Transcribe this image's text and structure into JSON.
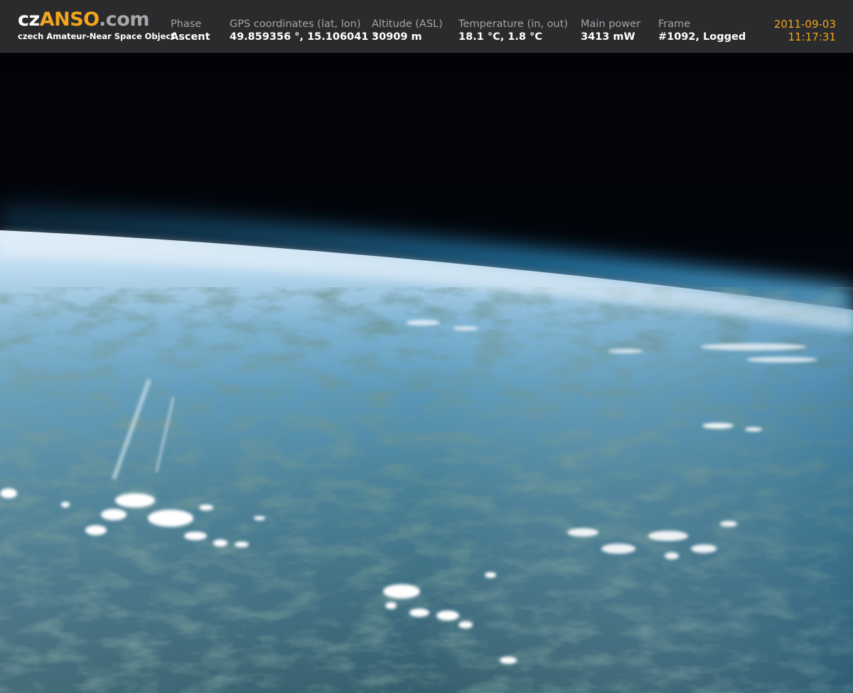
{
  "brand": {
    "logo_prefix": "cz",
    "logo_accent": "ANSO",
    "logo_suffix": ".com",
    "tagline": "czech Amateur-Near Space Object"
  },
  "telemetry": {
    "phase": {
      "label": "Phase",
      "value": "Ascent"
    },
    "gps": {
      "label": "GPS coordinates (lat, lon)",
      "value": "49.859356 °, 15.106041 °"
    },
    "altitude": {
      "label": "Altitude (ASL)",
      "value": "30909 m"
    },
    "temperature": {
      "label": "Temperature (in, out)",
      "value": "18.1 °C, 1.8 °C"
    },
    "power": {
      "label": "Main power",
      "value": "3413 mW"
    },
    "frame": {
      "label": "Frame",
      "value": "#1092, Logged"
    }
  },
  "timestamp": {
    "date": "2011-09-03",
    "time": "11:17:31"
  },
  "colors": {
    "header_bg": "#2a2b2d",
    "accent": "#f3a51d",
    "label_gray": "#a3a4a6",
    "space_black": "#020306",
    "horizon_blue": "#2f9ad6",
    "haze": "#cfe4f3",
    "ground": "#3b6878"
  }
}
